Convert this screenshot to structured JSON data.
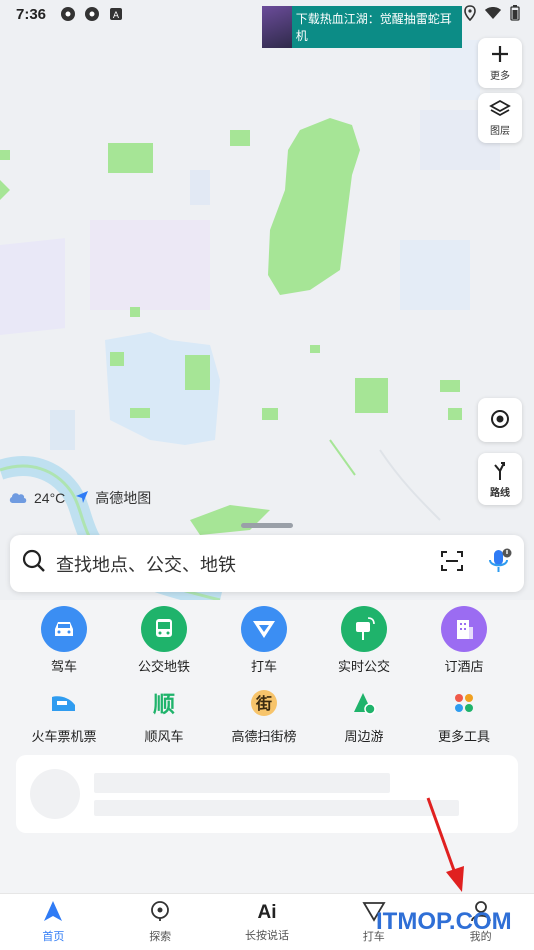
{
  "status_bar": {
    "time": "7:36"
  },
  "ad_banner": {
    "text": "下载热血江湖：觉醒抽雷蛇耳机"
  },
  "map_controls": {
    "more_label": "更多",
    "layers_label": "图层",
    "route_label": "路线"
  },
  "weather": {
    "temperature": "24°C",
    "brand": "高德地图"
  },
  "search": {
    "placeholder": "查找地点、公交、地铁"
  },
  "quick_row1": [
    {
      "label": "驾车",
      "color": "#3b8ef3"
    },
    {
      "label": "公交地铁",
      "color": "#1fb36b"
    },
    {
      "label": "打车",
      "color": "#3b8ef3"
    },
    {
      "label": "实时公交",
      "color": "#1fb36b"
    },
    {
      "label": "订酒店",
      "color": "#9b6cf2"
    }
  ],
  "quick_row2": [
    {
      "label": "火车票机票",
      "color": "#2f9cf0"
    },
    {
      "label": "顺风车",
      "color": "#1fb36b"
    },
    {
      "label": "高德扫街榜",
      "color": "#f0a020"
    },
    {
      "label": "周边游",
      "color": "#1fb36b"
    },
    {
      "label": "更多工具",
      "color": "#f05a4a"
    }
  ],
  "tabs": [
    {
      "label": "首页",
      "icon": "navigation-arrow-icon",
      "active": true
    },
    {
      "label": "探索",
      "icon": "location-pin-icon",
      "active": false
    },
    {
      "label": "长按说话",
      "icon": "ai-voice-icon",
      "active": false
    },
    {
      "label": "打车",
      "icon": "taxi-icon",
      "active": false
    },
    {
      "label": "我的",
      "icon": "user-icon",
      "active": false
    }
  ],
  "watermark": {
    "text": "ITMOP.COM"
  }
}
